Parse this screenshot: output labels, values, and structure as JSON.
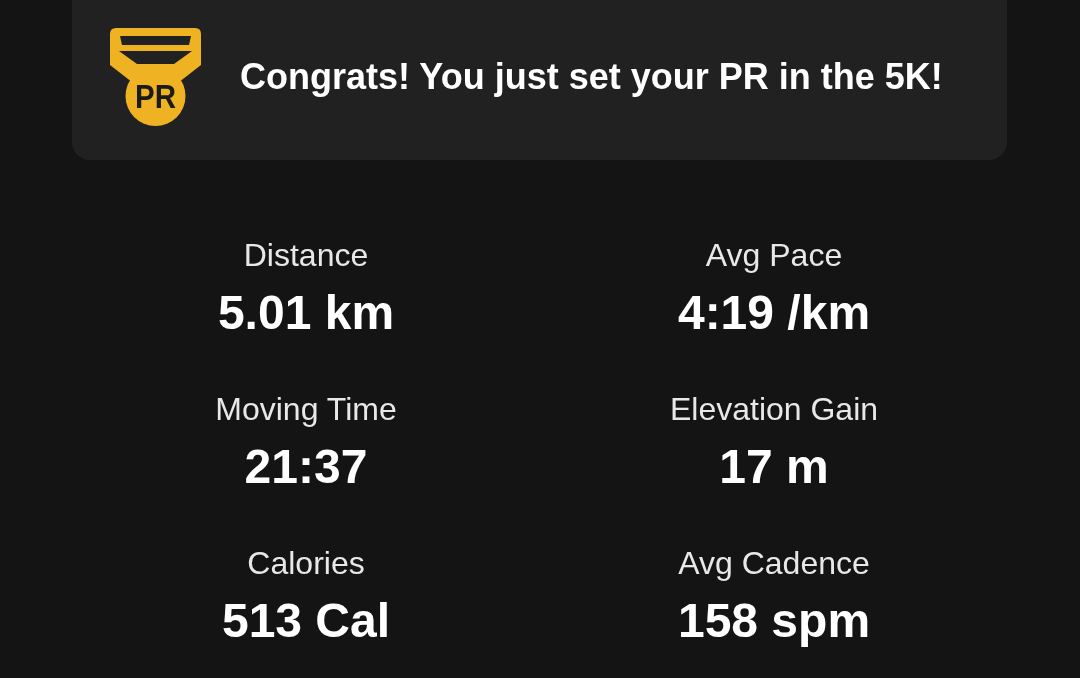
{
  "banner": {
    "badge": "PR",
    "message": "Congrats! You just set your PR in the 5K!"
  },
  "stats": [
    {
      "label": "Distance",
      "value": "5.01 km"
    },
    {
      "label": "Avg Pace",
      "value": "4:19 /km"
    },
    {
      "label": "Moving Time",
      "value": "21:37"
    },
    {
      "label": "Elevation Gain",
      "value": "17 m"
    },
    {
      "label": "Calories",
      "value": "513 Cal"
    },
    {
      "label": "Avg Cadence",
      "value": "158 spm"
    }
  ]
}
